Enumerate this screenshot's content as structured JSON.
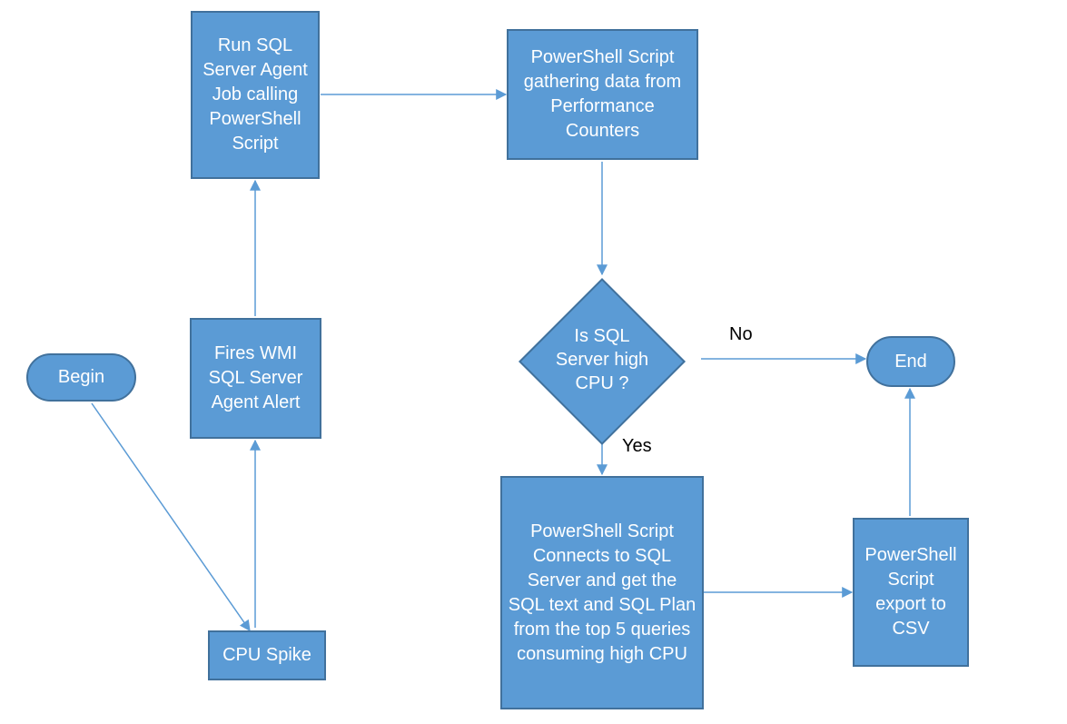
{
  "nodes": {
    "begin": {
      "label": "Begin"
    },
    "cpu_spike": {
      "label": "CPU Spike"
    },
    "fires_alert": {
      "label": "Fires WMI SQL Server Agent Alert"
    },
    "run_job": {
      "label": "Run SQL Server Agent Job calling PowerShell Script"
    },
    "gather": {
      "label": "PowerShell Script gathering data from Performance Counters"
    },
    "decision": {
      "label": "Is SQL Server high CPU ?"
    },
    "get_sql": {
      "label": "PowerShell Script Connects to SQL Server and get the SQL text and SQL Plan from the top 5 queries consuming high CPU"
    },
    "export": {
      "label": "PowerShell Script export to CSV"
    },
    "end": {
      "label": "End"
    }
  },
  "edge_labels": {
    "yes": "Yes",
    "no": "No"
  }
}
